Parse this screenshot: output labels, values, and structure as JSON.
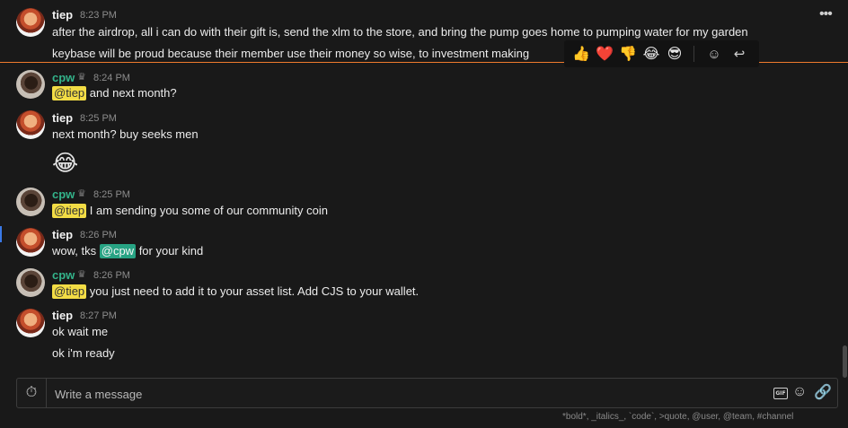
{
  "header_actions": {
    "more_label": "•••"
  },
  "reaction_bar": {
    "emojis": [
      "👍",
      "❤️",
      "👎",
      "😂",
      "😎"
    ],
    "add_reaction_icon": "☺",
    "reply_icon": "↩"
  },
  "messages": [
    {
      "author": "tiep",
      "time": "8:23 PM",
      "lines": [
        "after the airdrop, all i can do with their gift is, send the xlm to the store, and bring the pump goes home to pumping water for my garden",
        "keybase will be proud because their member use their money so wise, to investment making"
      ]
    },
    {
      "author": "cpw",
      "time": "8:24 PM",
      "mention": "@tiep",
      "text": " and next month?"
    },
    {
      "author": "tiep",
      "time": "8:25 PM",
      "text": "next month? buy seeks men",
      "emoji": "😂"
    },
    {
      "author": "cpw",
      "time": "8:25 PM",
      "mention": "@tiep",
      "text": " I am sending you some of our community coin"
    },
    {
      "author": "tiep",
      "time": "8:26 PM",
      "text_pre": "wow, tks ",
      "mention": "@cpw",
      "text_post": " for your kind"
    },
    {
      "author": "cpw",
      "time": "8:26 PM",
      "mention": "@tiep",
      "text": " you just need to add it to your asset list. Add CJS to your wallet."
    },
    {
      "author": "tiep",
      "time": "8:27 PM",
      "lines": [
        "ok wait me",
        "ok i'm ready"
      ]
    }
  ],
  "composer": {
    "placeholder": "Write a message",
    "gif_label": "GIF",
    "hint": "*bold*, _italics_, `code`, >quote, @user, @team, #channel"
  },
  "colors": {
    "self_mention": "#f2dc45",
    "other_mention": "#27a383",
    "cpw_name": "#33b38a",
    "divider": "#ef7a2d"
  }
}
